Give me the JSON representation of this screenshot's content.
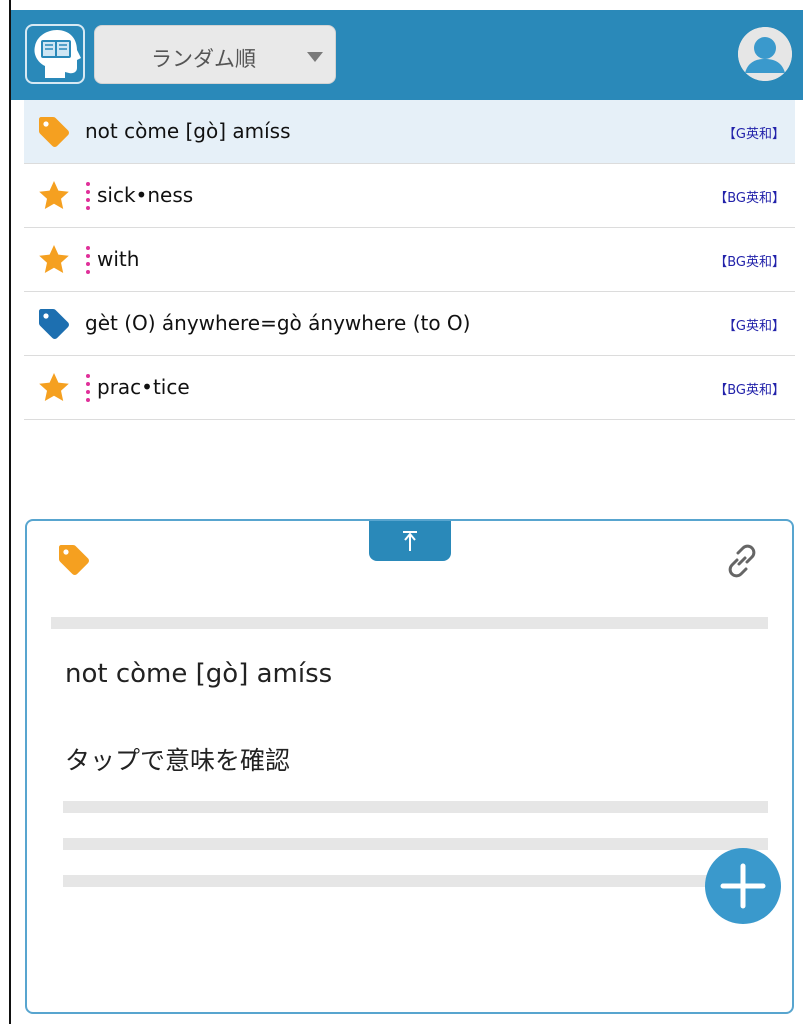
{
  "header": {
    "sort_select": {
      "value": "ランダム順"
    }
  },
  "list": {
    "items": [
      {
        "icon": "tag-icon",
        "icon_color": "#f5a020",
        "text": "not còme [gò] amíss",
        "dict": "【G英和】",
        "selected": true,
        "marked": false
      },
      {
        "icon": "star-icon",
        "icon_color": "#f5a020",
        "text": "sick•ness",
        "dict": "【BG英和】",
        "selected": false,
        "marked": true
      },
      {
        "icon": "star-icon",
        "icon_color": "#f5a020",
        "text": "with",
        "dict": "【BG英和】",
        "selected": false,
        "marked": true
      },
      {
        "icon": "tag-icon",
        "icon_color": "#1d6fb0",
        "text": "gèt (O) ánywhere=gò ánywhere (to O)",
        "dict": "【G英和】",
        "selected": false,
        "marked": false
      },
      {
        "icon": "star-icon",
        "icon_color": "#f5a020",
        "text": "prac•tice",
        "dict": "【BG英和】",
        "selected": false,
        "marked": true
      }
    ]
  },
  "detail": {
    "term": "not còme [gò] amíss",
    "hint": "タップで意味を確認",
    "tag_color": "#f5a020"
  },
  "colors": {
    "header_bg": "#2a89b9",
    "accent": "#3a99cc",
    "selected_row_bg": "#e6f0f8",
    "mark_dots": "#e0309a",
    "dict_label": "#2222aa"
  }
}
